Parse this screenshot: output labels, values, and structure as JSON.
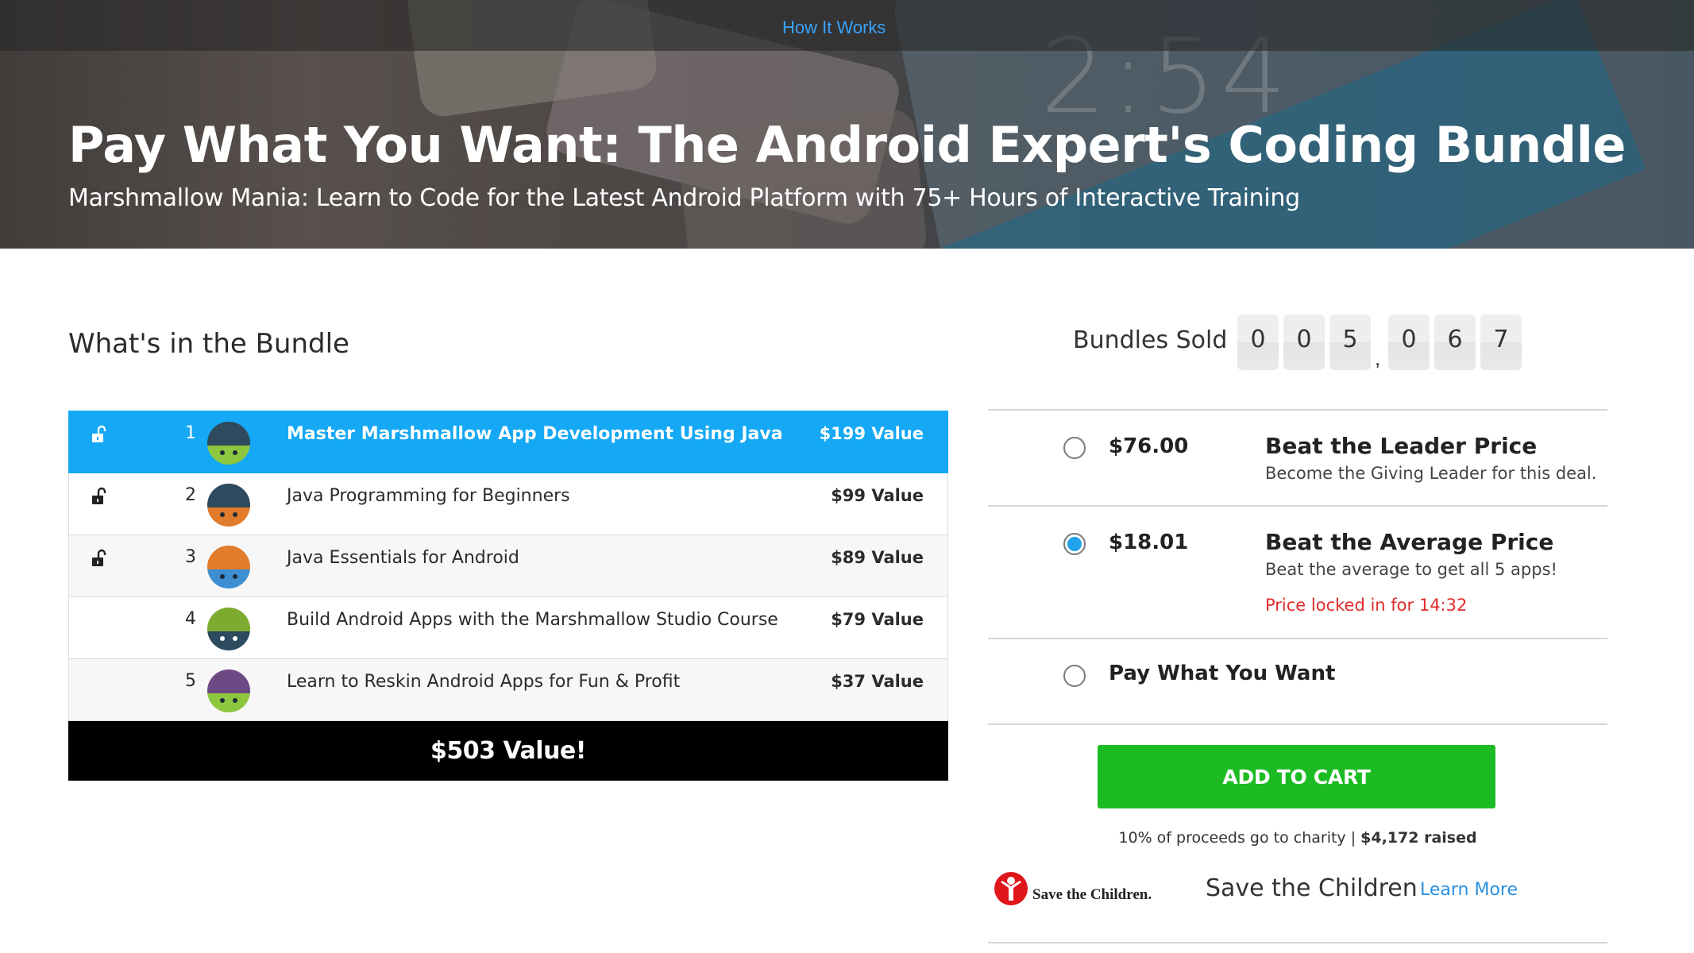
{
  "nav": {
    "how_it_works": "How It Works"
  },
  "hero": {
    "title": "Pay What You Want: The Android Expert's Coding Bundle",
    "subtitle": "Marshmallow Mania: Learn to Code for the Latest Android Platform with 75+ Hours of Interactive Training",
    "clock": "2:54"
  },
  "bundle": {
    "heading": "What's in the Bundle",
    "items": [
      {
        "num": "1",
        "title": "Master Marshmallow App Development Using Java",
        "value": "$199 Value",
        "locked_icon": "unlock-icon",
        "dome": "#2e4a5e",
        "bottom": "#8dc63f"
      },
      {
        "num": "2",
        "title": "Java Programming for Beginners",
        "value": "$99 Value",
        "locked_icon": "unlock-icon",
        "dome": "#2e4a5e",
        "bottom": "#e07c2c"
      },
      {
        "num": "3",
        "title": "Java Essentials for Android",
        "value": "$89 Value",
        "locked_icon": "unlock-icon",
        "dome": "#e07c2c",
        "bottom": "#3d8fd1"
      },
      {
        "num": "4",
        "title": "Build Android Apps with the Marshmallow Studio Course",
        "value": "$79 Value",
        "dome": "#7cab2f",
        "bottom": "#2e4a5e"
      },
      {
        "num": "5",
        "title": "Learn to Reskin Android Apps for Fun & Profit",
        "value": "$37 Value",
        "dome": "#6e4a85",
        "bottom": "#8dc63f"
      }
    ],
    "total": "$503 Value!"
  },
  "sold": {
    "label": "Bundles Sold",
    "digits": [
      "0",
      "0",
      "5",
      "0",
      "6",
      "7"
    ],
    "separator": ","
  },
  "options": [
    {
      "price": "$76.00",
      "title": "Beat the Leader Price",
      "desc": "Become the Giving Leader for this deal.",
      "selected": false
    },
    {
      "price": "$18.01",
      "title": "Beat the Average Price",
      "desc": "Beat the average to get all 5 apps!",
      "timer": "Price locked in for 14:32",
      "selected": true
    },
    {
      "price": "",
      "title": "Pay What You Want",
      "selected": false
    }
  ],
  "cart": {
    "label": "ADD TO CART"
  },
  "charity": {
    "line": "10% of proceeds go to charity",
    "sep": "|",
    "raised": "$4,172 raised",
    "logo_text": "Save the Children.",
    "name": "Save the Children",
    "learn_more": "Learn More"
  },
  "colors": {
    "accent": "#14a8f5",
    "cart": "#1dbb23",
    "timer": "#e02b2b",
    "link": "#2a8fe0"
  }
}
